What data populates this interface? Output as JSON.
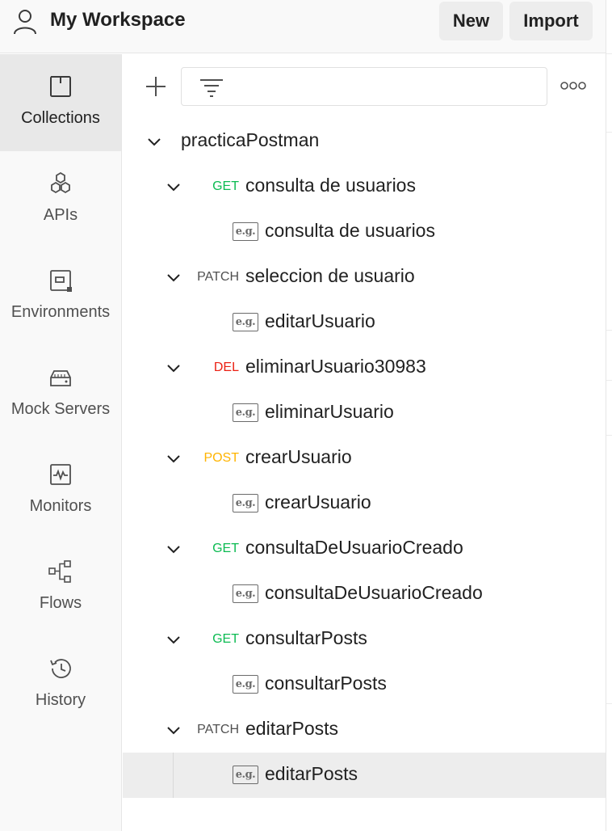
{
  "header": {
    "workspace_title": "My Workspace",
    "new_label": "New",
    "import_label": "Import",
    "user_icon": "user-icon"
  },
  "sidebar": {
    "items": [
      {
        "label": "Collections",
        "icon": "collections-icon",
        "active": true
      },
      {
        "label": "APIs",
        "icon": "apis-icon"
      },
      {
        "label": "Environments",
        "icon": "environments-icon"
      },
      {
        "label": "Mock Servers",
        "icon": "mock-servers-icon"
      },
      {
        "label": "Monitors",
        "icon": "monitors-icon"
      },
      {
        "label": "Flows",
        "icon": "flows-icon"
      },
      {
        "label": "History",
        "icon": "history-icon"
      }
    ]
  },
  "toolbar": {
    "add_icon": "plus-icon",
    "filter_icon": "filter-icon",
    "more_icon": "more-options-icon",
    "search_placeholder": ""
  },
  "colors": {
    "GET": "#0cbb52",
    "PATCH": "#505050",
    "DEL": "#eb2013",
    "POST": "#ffb400"
  },
  "collection": {
    "name": "practicaPostman",
    "requests": [
      {
        "method": "GET",
        "name": "consulta de usuarios",
        "example": "consulta de usuarios"
      },
      {
        "method": "PATCH",
        "name": "seleccion de usuario",
        "example": "editarUsuario"
      },
      {
        "method": "DEL",
        "name": "eliminarUsuario30983",
        "example": "eliminarUsuario"
      },
      {
        "method": "POST",
        "name": "crearUsuario",
        "example": "crearUsuario"
      },
      {
        "method": "GET",
        "name": "consultaDeUsuarioCreado",
        "example": "consultaDeUsuarioCreado"
      },
      {
        "method": "GET",
        "name": "consultarPosts",
        "example": "consultarPosts"
      },
      {
        "method": "PATCH",
        "name": "editarPosts",
        "example": "editarPosts"
      }
    ],
    "example_badge": "e.g."
  }
}
